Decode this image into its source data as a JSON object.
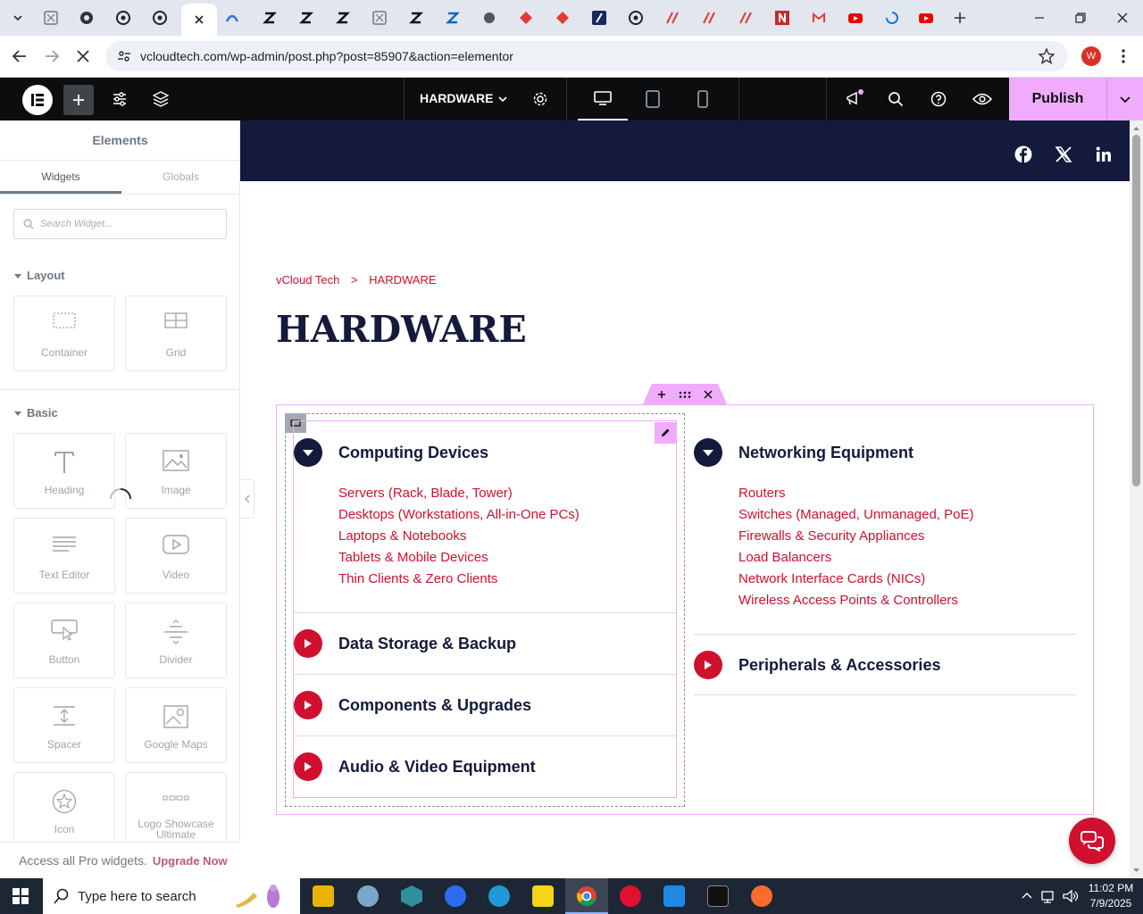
{
  "browser": {
    "url": "vcloudtech.com/wp-admin/post.php?post=85907&action=elementor",
    "profile_initial": "W"
  },
  "editor": {
    "page_selector": "HARDWARE",
    "publish_label": "Publish"
  },
  "sidebar": {
    "title": "Elements",
    "tabs": [
      "Widgets",
      "Globals"
    ],
    "search_placeholder": "Search Widget...",
    "layout_section": "Layout",
    "basic_section": "Basic",
    "layout_widgets": [
      "Container",
      "Grid"
    ],
    "basic_widgets": [
      "Heading",
      "Image",
      "Text Editor",
      "Video",
      "Button",
      "Divider",
      "Spacer",
      "Google Maps",
      "Icon",
      "Logo Showcase Ultimate"
    ],
    "footer_text": "Access all Pro widgets.",
    "footer_link": "Upgrade Now"
  },
  "page": {
    "breadcrumb_home": "vCloud Tech",
    "breadcrumb_sep": ">",
    "breadcrumb_current": "HARDWARE",
    "title": "HARDWARE",
    "left_accordion": [
      {
        "title": "Computing Devices",
        "open": true,
        "items": [
          "Servers (Rack, Blade, Tower)",
          "Desktops (Workstations, All-in-One PCs)",
          "Laptops & Notebooks",
          "Tablets & Mobile Devices",
          "Thin Clients & Zero Clients"
        ]
      },
      {
        "title": "Data Storage & Backup",
        "open": false
      },
      {
        "title": "Components & Upgrades",
        "open": false
      },
      {
        "title": "Audio & Video Equipment",
        "open": false
      }
    ],
    "right_accordion": [
      {
        "title": "Networking Equipment",
        "open": true,
        "items": [
          "Routers",
          "Switches (Managed, Unmanaged, PoE)",
          "Firewalls & Security Appliances",
          "Load Balancers",
          "Network Interface Cards (NICs)",
          "Wireless Access Points & Controllers"
        ]
      },
      {
        "title": "Peripherals & Accessories",
        "open": false
      }
    ]
  },
  "taskbar": {
    "search_placeholder": "Type here to search",
    "time": "11:02 PM",
    "date": "7/9/2025"
  },
  "colors": {
    "accent_red": "#d0102f",
    "navy": "#131a3b",
    "elementor_pink": "#f0abfc",
    "editor_bar": "#0c0d0e"
  }
}
